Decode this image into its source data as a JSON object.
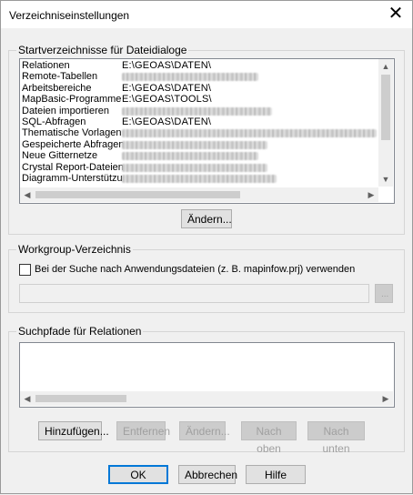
{
  "window": {
    "title": "Verzeichniseinstellungen",
    "close_glyph": "✕"
  },
  "startdirs": {
    "group_label": "Startverzeichnisse für Dateidialoge",
    "rows": [
      {
        "name": "Relationen",
        "path": "E:\\GEOAS\\DATEN\\",
        "blurred": false
      },
      {
        "name": "Remote-Tabellen",
        "path": "",
        "blurred": true,
        "blur_width": 150
      },
      {
        "name": "Arbeitsbereiche",
        "path": "E:\\GEOAS\\DATEN\\",
        "blurred": false
      },
      {
        "name": "MapBasic-Programme",
        "path": "E:\\GEOAS\\TOOLS\\",
        "blurred": false
      },
      {
        "name": "Dateien importieren",
        "path": "",
        "blurred": true,
        "blur_width": 165
      },
      {
        "name": "SQL-Abfragen",
        "path": "E:\\GEOAS\\DATEN\\",
        "blurred": false
      },
      {
        "name": "Thematische Vorlagen",
        "path": "",
        "blurred": true,
        "blur_width": 280
      },
      {
        "name": "Gespeicherte Abfragen",
        "path": "",
        "blurred": true,
        "blur_width": 160
      },
      {
        "name": "Neue Gitternetze",
        "path": "",
        "blurred": true,
        "blur_width": 150
      },
      {
        "name": "Crystal Report-Dateien",
        "path": "",
        "blurred": true,
        "blur_width": 160
      },
      {
        "name": "Diagramm-Unterstützu",
        "path": "",
        "blurred": true,
        "blur_width": 170
      }
    ],
    "change_button": "Ändern..."
  },
  "workgroup": {
    "group_label": "Workgroup-Verzeichnis",
    "checkbox_label": "Bei der Suche nach Anwendungsdateien (z. B. mapinfow.prj) verwenden",
    "checked": false,
    "path_value": "",
    "browse_label": "..."
  },
  "searchpaths": {
    "group_label": "Suchpfade für Relationen",
    "add_button": "Hinzufügen...",
    "remove_button": "Entfernen",
    "change_button": "Ändern...",
    "up_button": "Nach oben",
    "down_button": "Nach unten"
  },
  "footer": {
    "ok_button": "OK",
    "cancel_button": "Abbrechen",
    "help_button": "Hilfe"
  },
  "icons": {
    "up": "▲",
    "down": "▼",
    "left": "◀",
    "right": "▶"
  }
}
